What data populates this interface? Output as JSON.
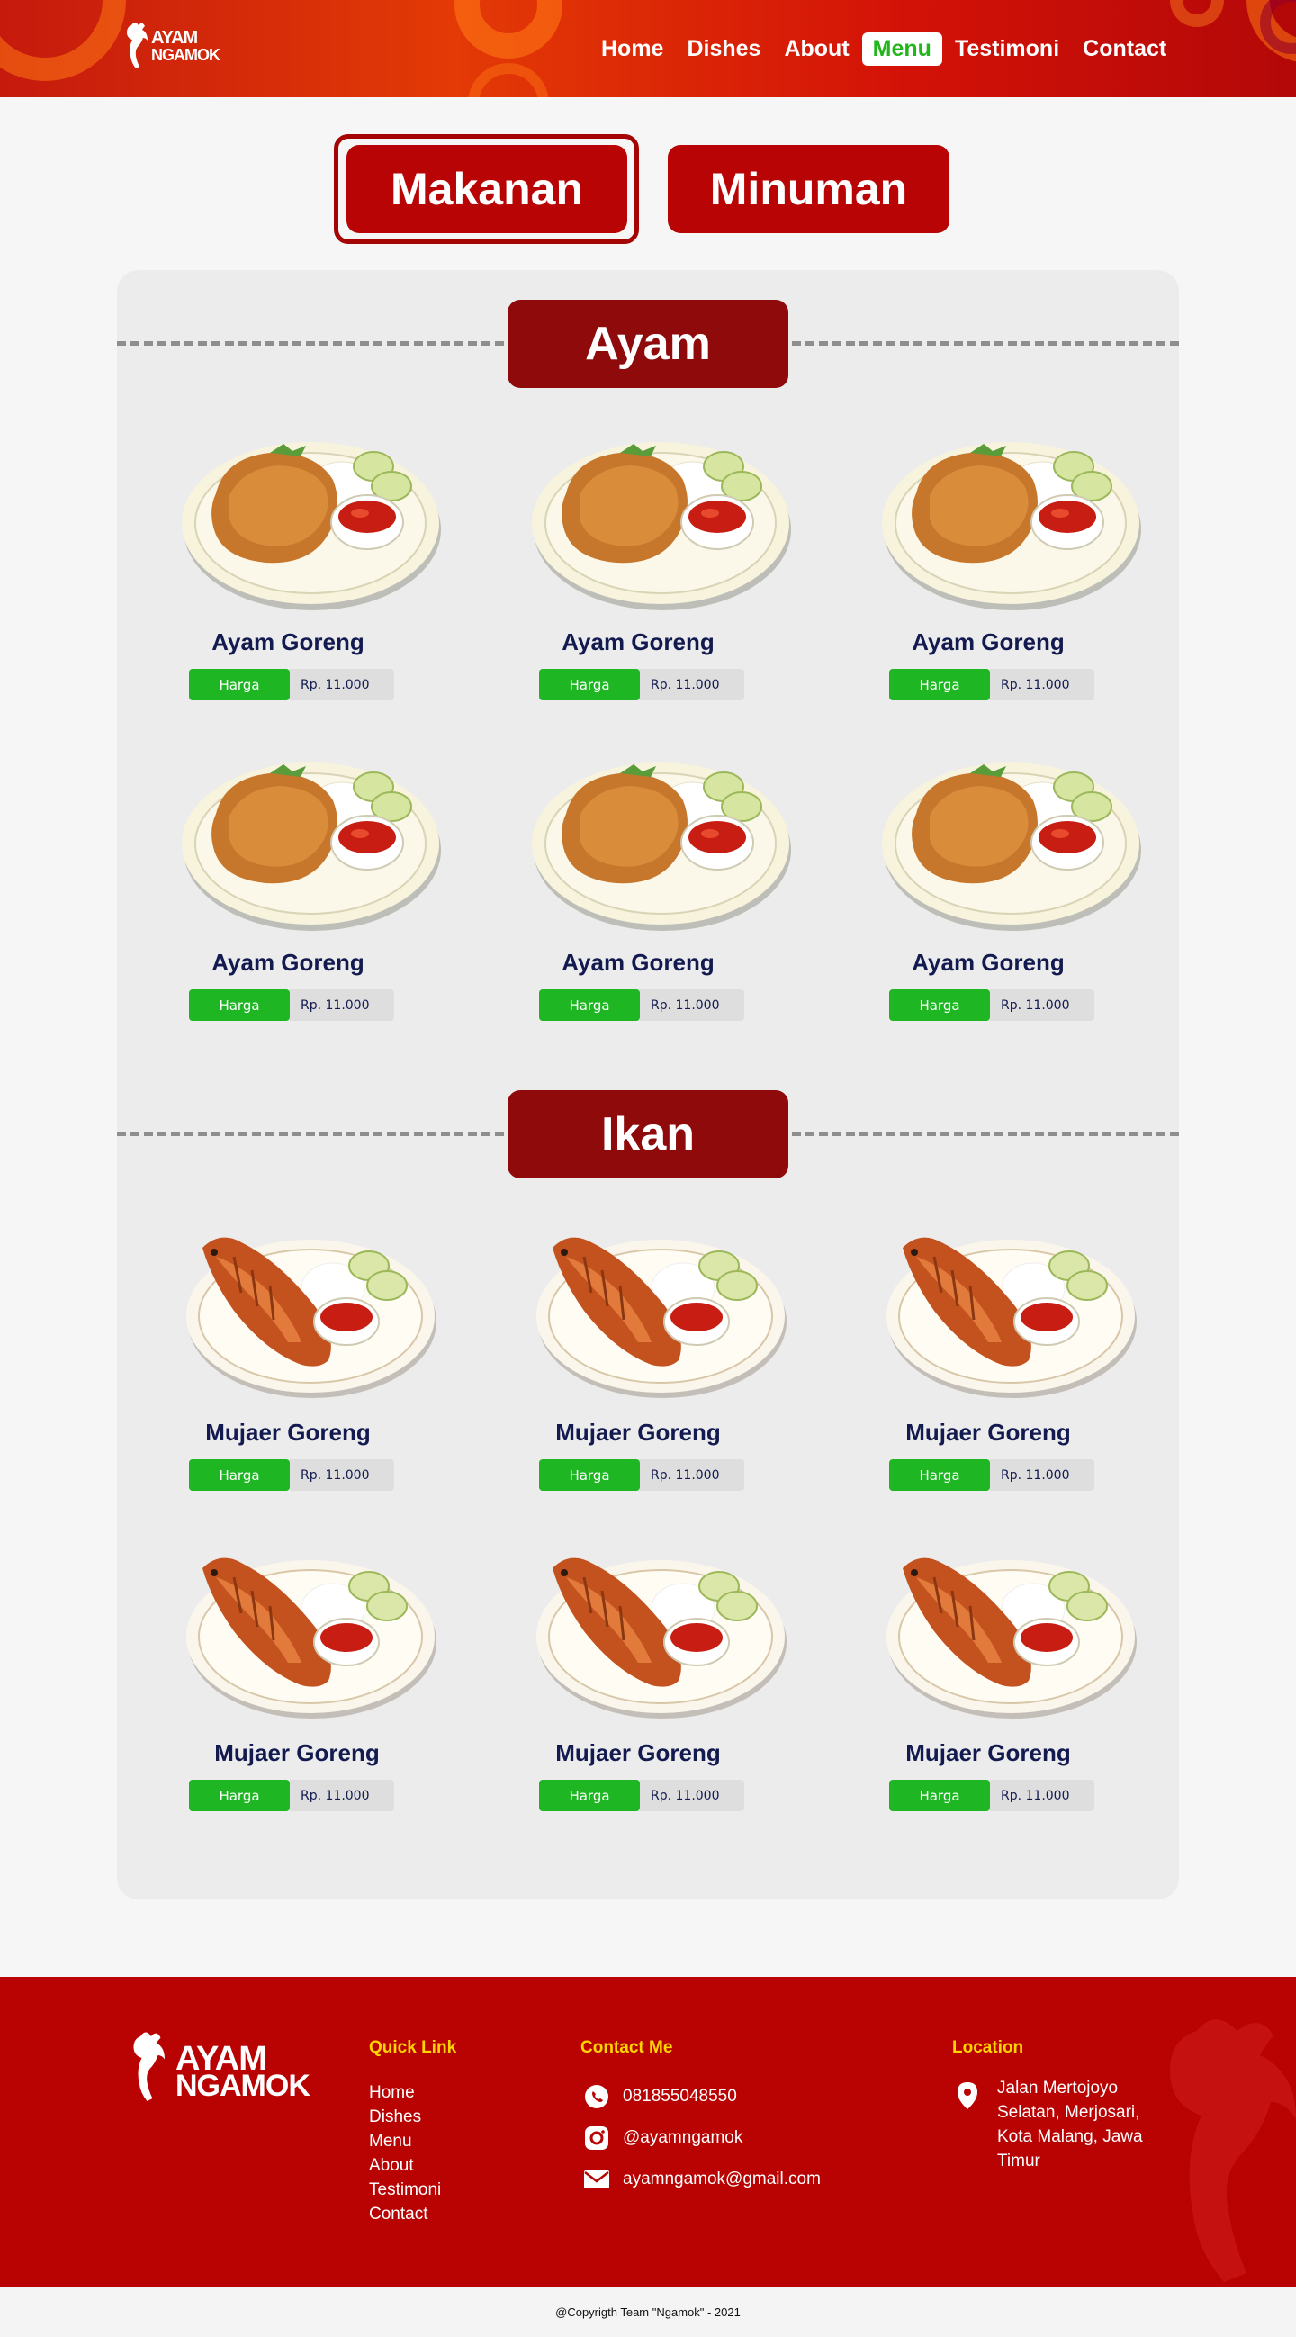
{
  "brand": {
    "line1": "AYAM",
    "line2": "NGAMOK"
  },
  "nav": {
    "items": [
      {
        "label": "Home"
      },
      {
        "label": "Dishes"
      },
      {
        "label": "About"
      },
      {
        "label": "Menu",
        "active": true
      },
      {
        "label": "Testimoni"
      },
      {
        "label": "Contact"
      }
    ]
  },
  "category_tabs": {
    "makanan": "Makanan",
    "minuman": "Minuman"
  },
  "sections": [
    {
      "title": "Ayam",
      "items": [
        {
          "name": "Ayam Goreng",
          "price_label": "Harga",
          "price": "Rp. 11.000"
        },
        {
          "name": "Ayam Goreng",
          "price_label": "Harga",
          "price": "Rp. 11.000"
        },
        {
          "name": "Ayam Goreng",
          "price_label": "Harga",
          "price": "Rp. 11.000"
        },
        {
          "name": "Ayam Goreng",
          "price_label": "Harga",
          "price": "Rp. 11.000"
        },
        {
          "name": "Ayam Goreng",
          "price_label": "Harga",
          "price": "Rp. 11.000"
        },
        {
          "name": "Ayam Goreng",
          "price_label": "Harga",
          "price": "Rp. 11.000"
        }
      ]
    },
    {
      "title": "Ikan",
      "items": [
        {
          "name": "Mujaer Goreng",
          "price_label": "Harga",
          "price": "Rp. 11.000"
        },
        {
          "name": "Mujaer Goreng",
          "price_label": "Harga",
          "price": "Rp. 11.000"
        },
        {
          "name": "Mujaer Goreng",
          "price_label": "Harga",
          "price": "Rp. 11.000"
        },
        {
          "name": "Mujaer Goreng",
          "price_label": "Harga",
          "price": "Rp. 11.000"
        },
        {
          "name": "Mujaer Goreng",
          "price_label": "Harga",
          "price": "Rp. 11.000"
        },
        {
          "name": "Mujaer Goreng",
          "price_label": "Harga",
          "price": "Rp. 11.000"
        }
      ]
    }
  ],
  "footer": {
    "quick_link": {
      "title": "Quick Link",
      "links": [
        "Home",
        "Dishes",
        "Menu",
        "About",
        "Testimoni",
        "Contact"
      ]
    },
    "contact": {
      "title": "Contact Me",
      "phone": "081855048550",
      "instagram": "@ayamngamok",
      "email": "ayamngamok@gmail.com"
    },
    "location": {
      "title": "Location",
      "address": "Jalan Mertojoyo Selatan, Merjosari, Kota Malang, Jawa Timur"
    }
  },
  "copyright": "@Copyrigth Team \"Ngamok\" - 2021",
  "colors": {
    "primary_red": "#b80404",
    "dark_red": "#8f0a0a",
    "green": "#1eb623",
    "navy": "#121a50",
    "yellow": "#ffd400"
  }
}
